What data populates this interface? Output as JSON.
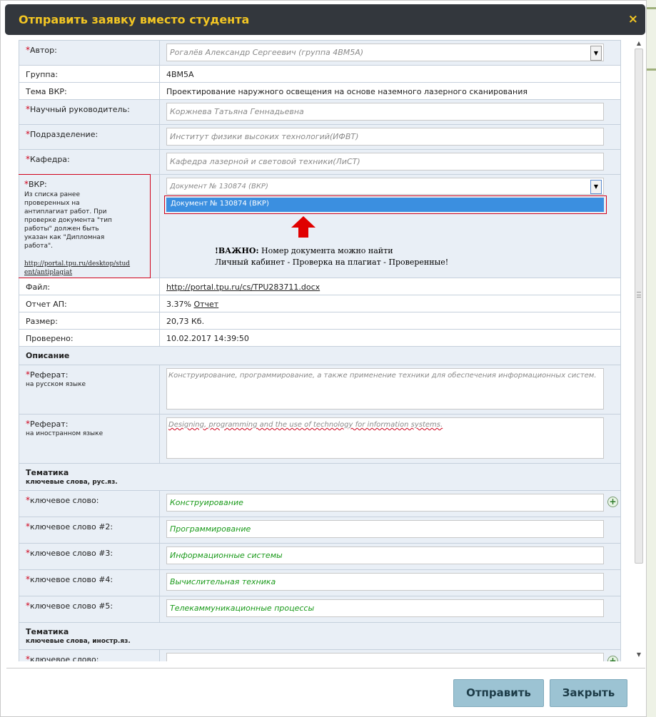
{
  "dialog": {
    "title": "Отправить заявку вместо студента",
    "close_glyph": "×"
  },
  "form": {
    "author": {
      "label": "Автор:",
      "value": "Рогалёв Александр Сергеевич (группа 4ВМ5А)"
    },
    "group": {
      "label": "Группа:",
      "value": "4ВМ5А"
    },
    "thesis_topic": {
      "label": "Тема ВКР:",
      "value": "Проектирование наружного освещения на основе наземного лазерного сканирования"
    },
    "supervisor": {
      "label": "Научный руководитель:",
      "value": "Коржнева Татьяна Геннадьевна"
    },
    "division": {
      "label": "Подразделение:",
      "value": "Институт физики высоких технологий(ИФВТ)"
    },
    "department": {
      "label": "Кафедра:",
      "value": "Кафедра лазерной и световой техники(ЛиСТ)"
    },
    "vkr": {
      "label": "ВКР:",
      "hint": "Из списка ранее проверенных на антиплагиат работ. При проверке документа \"тип работы\" должен быть указан как \"Дипломная работа\".",
      "link": "http://portal.tpu.ru/desktop/student/antiplagiat",
      "selected": "Документ № 130874 (ВКР)",
      "option_highlighted": "Документ № 130874 (ВКР)",
      "note_bold": "!ВАЖНО:",
      "note_line1": " Номер документа можно найти",
      "note_line2": "Личный кабинет - Проверка на плагиат - Проверенные!"
    },
    "file": {
      "label": "Файл:",
      "value": "http://portal.tpu.ru/cs/TPU283711.docx"
    },
    "report": {
      "label": "Отчет АП:",
      "percent": "3.37%",
      "link": "Отчет"
    },
    "size": {
      "label": "Размер:",
      "value": "20,73 Кб."
    },
    "checked": {
      "label": "Проверено:",
      "value": "10.02.2017 14:39:50"
    },
    "description_header": "Описание",
    "abstract_ru": {
      "label": "Реферат:",
      "sub": "на русском языке",
      "value": "Конструирование, программирование, а также применение техники  для обеспечения информационных систем."
    },
    "abstract_en": {
      "label": "Реферат:",
      "sub": "на иностранном языке",
      "value": "Designing, programming and the use of technology for information systems."
    },
    "topics_ru_header": "Тематика",
    "topics_ru_sub": "ключевые слова, рус.яз.",
    "keywords_ru": [
      {
        "label": "ключевое слово:",
        "value": "Конструирование"
      },
      {
        "label": "ключевое слово #2:",
        "value": "Программирование"
      },
      {
        "label": "ключевое слово #3:",
        "value": "Информационные системы"
      },
      {
        "label": "ключевое слово #4:",
        "value": "Вычислительная техника"
      },
      {
        "label": "ключевое слово #5:",
        "value": "Телекаммуникационные процессы"
      }
    ],
    "topics_en_header": "Тематика",
    "topics_en_sub": "ключевые слова, иностр.яз.",
    "keyword_en": {
      "label": "ключевое слово:",
      "value": ""
    }
  },
  "buttons": {
    "submit": "Отправить",
    "close": "Закрыть"
  },
  "icons": {
    "add": "plus-circle-icon",
    "dropdown": "chevron-down-icon",
    "annotation_arrow": "red-up-arrow-icon"
  },
  "colors": {
    "title_bg": "#33373d",
    "title_text": "#f3c623",
    "required": "#d0021b",
    "highlight": "#3b8fe0",
    "annotation": "#d0021b",
    "button_bg": "#9cc3d3",
    "keyword_text": "#1a9a1a"
  }
}
